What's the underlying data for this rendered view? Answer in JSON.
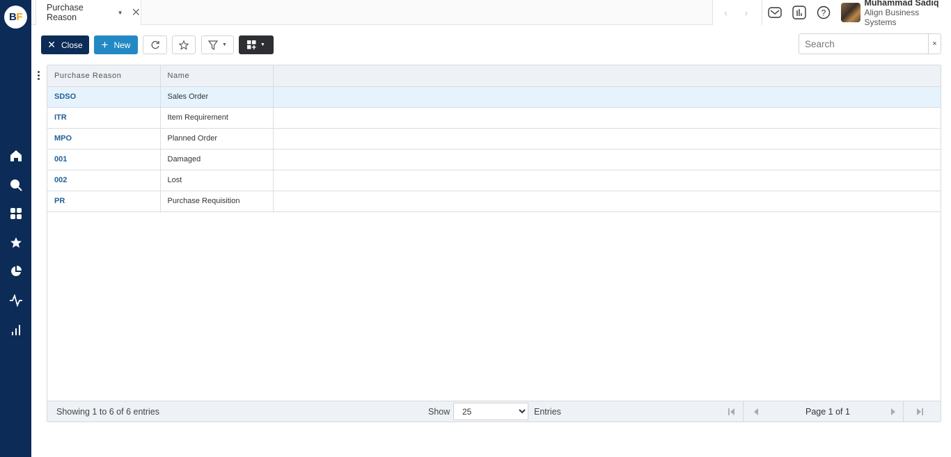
{
  "app": {
    "logo_b": "B",
    "logo_f": "F"
  },
  "tabs": [
    {
      "label": "Purchase Reason"
    }
  ],
  "user": {
    "name": "Muhammad Sadiq",
    "org": "Align Business Systems"
  },
  "sidebar": {
    "icons": [
      "home-icon",
      "search-icon",
      "apps-grid-icon",
      "star-icon",
      "pie-chart-icon",
      "activity-icon",
      "bar-chart-icon"
    ]
  },
  "toolbar": {
    "close_label": "Close",
    "new_label": "New"
  },
  "search": {
    "placeholder": "Search",
    "value": "",
    "clear_label": "×"
  },
  "table": {
    "columns": [
      "Purchase Reason",
      "Name"
    ],
    "rows": [
      {
        "code": "SDSO",
        "name": "Sales Order",
        "selected": true
      },
      {
        "code": "ITR",
        "name": "Item Requirement"
      },
      {
        "code": "MPO",
        "name": "Planned Order"
      },
      {
        "code": "001",
        "name": "Damaged"
      },
      {
        "code": "002",
        "name": "Lost"
      },
      {
        "code": "PR",
        "name": "Purchase Requisition"
      }
    ]
  },
  "footer": {
    "showing": "Showing 1 to 6 of 6 entries",
    "show_label": "Show",
    "page_size": "25",
    "entries_label": "Entries",
    "page_label": "Page 1 of 1"
  },
  "colors": {
    "sidebar": "#0c2b57",
    "primary": "#2389c4",
    "link": "#1f5f98",
    "selected_row": "#e6f3fd"
  }
}
